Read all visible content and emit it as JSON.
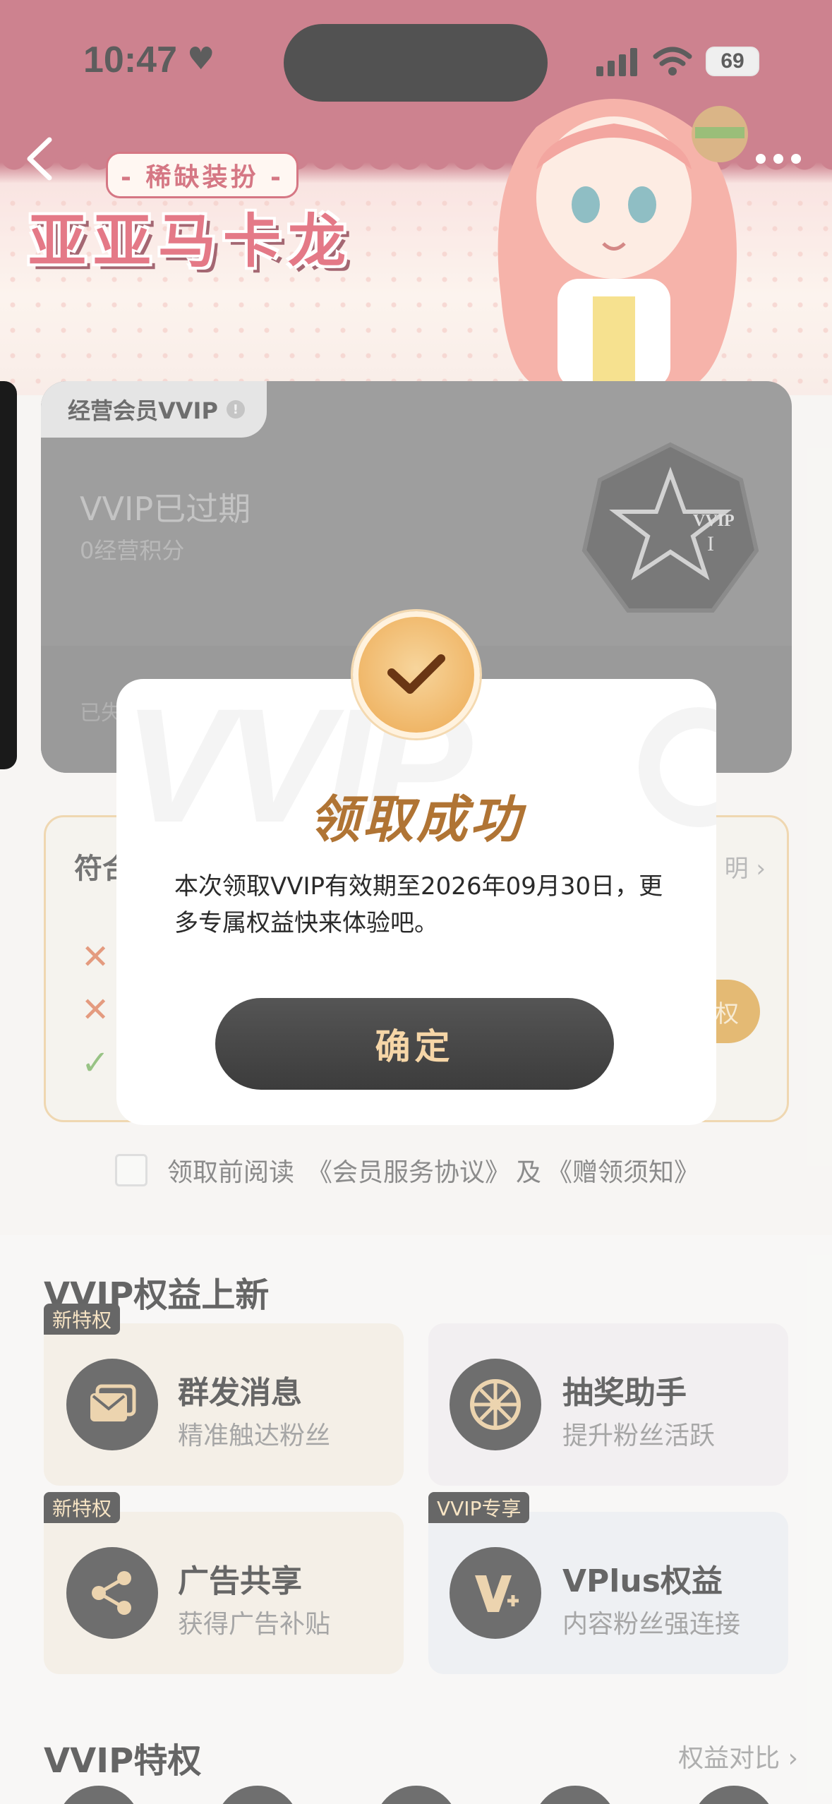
{
  "status_bar": {
    "time": "10:47",
    "battery": "69"
  },
  "banner": {
    "subtitle": "- 稀缺装扮 -",
    "title": "亚亚马卡龙"
  },
  "member_card": {
    "tag": "经营会员VVIP",
    "status": "VVIP已过期",
    "points": "0经营积分",
    "lower_text": "已失",
    "badge_text": "VVIP",
    "badge_level": "I"
  },
  "eligibility": {
    "title": "符合",
    "link": "明 ›",
    "button": "权"
  },
  "agreement": {
    "prefix": "领取前阅读",
    "link1": "《会员服务协议》",
    "and": "及",
    "link2": "《赠领须知》"
  },
  "perks_section": {
    "title": "VVIP权益上新",
    "items": [
      {
        "tag": "新特权",
        "title": "群发消息",
        "subtitle": "精准触达粉丝",
        "icon": "message-icon"
      },
      {
        "tag": "",
        "title": "抽奖助手",
        "subtitle": "提升粉丝活跃",
        "icon": "wheel-icon"
      },
      {
        "tag": "新特权",
        "title": "广告共享",
        "subtitle": "获得广告补贴",
        "icon": "share-icon"
      },
      {
        "tag": "VVIP专享",
        "title": "VPlus权益",
        "subtitle": "内容粉丝强连接",
        "icon": "vplus-icon"
      }
    ]
  },
  "privileges_section": {
    "title": "VVIP特权",
    "link": "权益对比 ›"
  },
  "modal": {
    "watermark": "VVIP",
    "title": "领取成功",
    "message": "本次领取VVIP有效期至2026年09月30日，更多专属权益快来体验吧。",
    "confirm": "确定"
  },
  "colors": {
    "accent_gold": "#b07434",
    "button_dark": "#3c3c3c",
    "button_text": "#f6d6a7"
  }
}
